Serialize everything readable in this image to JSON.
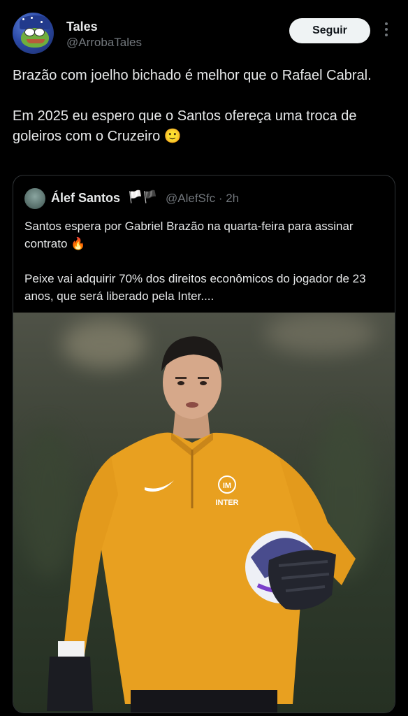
{
  "author": {
    "name": "Tales",
    "handle": "@ArrobaTales",
    "follow_label": "Seguir"
  },
  "tweet": {
    "paragraph1": "Brazão com joelho bichado é melhor que o Rafael Cabral.",
    "paragraph2": "Em 2025 eu espero que o Santos ofereça uma troca de goleiros com o Cruzeiro 🙂"
  },
  "quoted": {
    "name": "Álef Santos",
    "flags": "🏳️🏴",
    "handle_time": "@AlefSfc · 2h",
    "paragraph1": "Santos espera por Gabriel Brazão na quarta-feira para assinar contrato 🔥",
    "paragraph2": "Peixe vai adquirir 70% dos direitos econômicos do jogador de 23 anos, que será liberado pela Inter....",
    "image_text": "INTER"
  },
  "icons": {
    "more": "more-vertical-icon",
    "avatar": "pepe-wizard-avatar"
  },
  "colors": {
    "background": "#000000",
    "text": "#e7e9ea",
    "muted": "#71767b",
    "border": "#2f3336",
    "jersey": "#e8a020"
  }
}
